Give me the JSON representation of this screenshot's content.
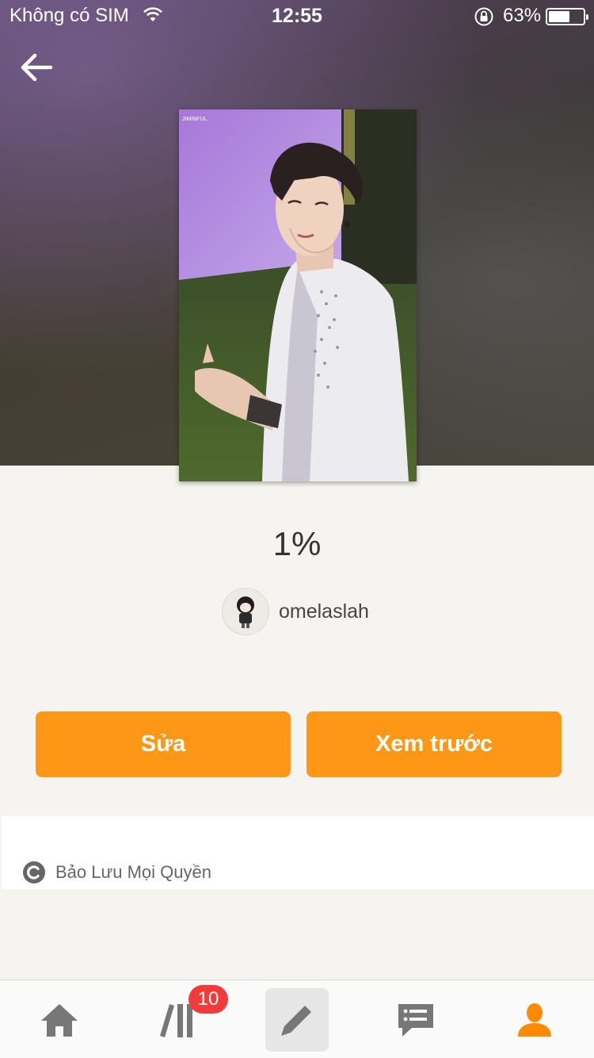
{
  "status_bar": {
    "carrier": "Không có SIM",
    "time": "12:55",
    "battery_percent": "63%",
    "battery_level": 0.63
  },
  "icons": {
    "back": "arrow-left-icon",
    "home": "home-icon",
    "library": "library-icon",
    "write": "pencil-icon",
    "messages": "chat-icon",
    "profile": "person-icon",
    "copyright": "copyright-icon"
  },
  "story": {
    "progress": "1%",
    "author": "omelaslah"
  },
  "actions": {
    "edit_label": "Sửa",
    "preview_label": "Xem trước"
  },
  "copyright": {
    "label": "Bảo Lưu Mọi Quyền"
  },
  "tab_bar": {
    "library_badge": "10",
    "active_tab": "profile"
  },
  "colors": {
    "accent": "#ff9716",
    "badge": "#f43b3b",
    "tab_inactive": "#777777",
    "tab_active": "#ff8a00"
  }
}
